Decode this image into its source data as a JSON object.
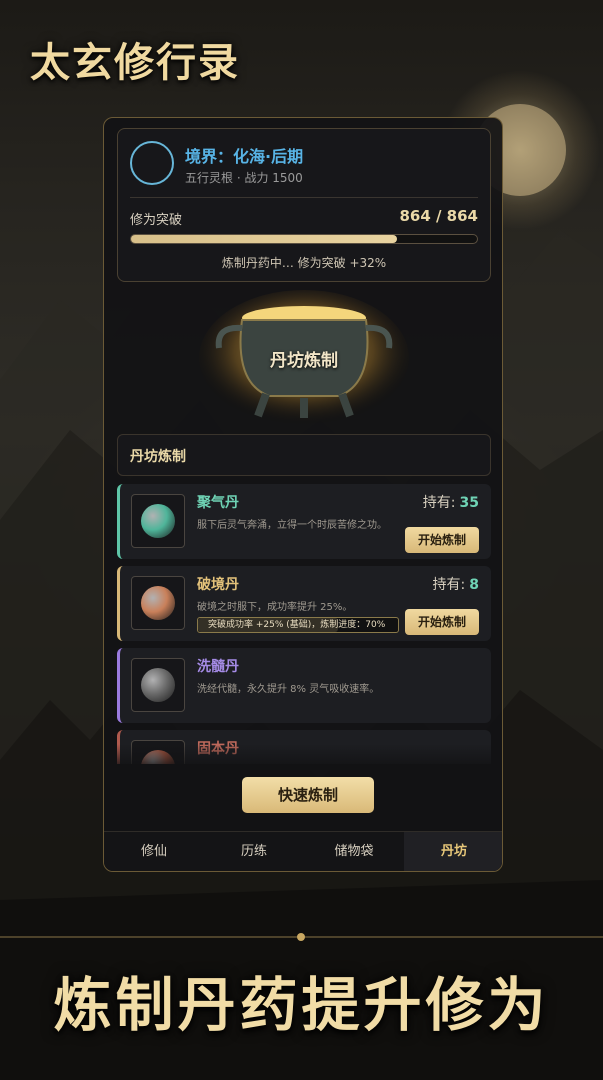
{
  "header": {
    "game_title": "太玄修行录"
  },
  "status": {
    "realm": "境界：化海·后期",
    "subinfo": "五行灵根 · 战力 1500",
    "cultivation_label": "修为突破",
    "cultivation_value": "864 / 864",
    "progress_fraction": 0.77,
    "status_line": "炼制丹药中… 修为突破 +32%"
  },
  "cauldron": {
    "label": "丹坊炼制"
  },
  "section": {
    "title": "丹坊炼制"
  },
  "pills": [
    {
      "name": "聚气丹",
      "desc": "服下后灵气奔涌，立得一个时辰苦修之功。",
      "hold_label": "持有:",
      "hold_count": "35",
      "button": "开始炼制",
      "accent": "#5fc6a8",
      "name_color": "#6fd3b5",
      "orb_color": "#4fb59a"
    },
    {
      "name": "破境丹",
      "desc": "破境之时服下，成功率提升 25%。",
      "hold_label": "持有:",
      "hold_count": "8",
      "button": "开始炼制",
      "bonus": "突破成功率 +25% (基础)，炼制进度：70%",
      "bonus_fraction": 0.7,
      "accent": "#d8b878",
      "name_color": "#e3c27a",
      "orb_color": "#c9805a"
    },
    {
      "name": "洗髓丹",
      "desc": "洗经代髓，永久提升 8% 灵气吸收速率。",
      "accent": "#9b7be0",
      "name_color": "#a58be6",
      "orb_color": "#6a6a6a"
    },
    {
      "name": "固本丹",
      "accent": "#b05a4e",
      "name_color": "#c06a5c",
      "orb_color": "#a8553f"
    }
  ],
  "quick_button": "快速炼制",
  "tabs": [
    {
      "label": "修仙"
    },
    {
      "label": "历练"
    },
    {
      "label": "储物袋"
    },
    {
      "label": "丹坊",
      "active": true
    }
  ],
  "slogan": "炼制丹药提升修为"
}
